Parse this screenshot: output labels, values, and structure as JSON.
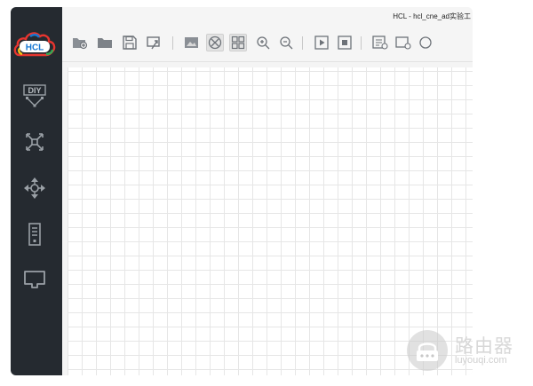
{
  "window": {
    "title": "HCL - hcl_cne_ad实验工"
  },
  "logo": {
    "text": "HCL"
  },
  "sidebar": {
    "items": [
      {
        "label": "DIY",
        "icon": "diy-icon"
      },
      {
        "icon": "router-icon"
      },
      {
        "icon": "switch-icon"
      },
      {
        "icon": "host-icon"
      },
      {
        "icon": "cable-icon"
      }
    ]
  },
  "toolbar": {
    "icons": [
      "new-project-icon",
      "open-folder-icon",
      "save-icon",
      "export-icon",
      "screenshot-icon",
      "topology-icon",
      "grid-view-icon",
      "zoom-in-icon",
      "zoom-out-icon",
      "start-icon",
      "stop-icon",
      "console-icon",
      "capture-icon",
      "circle-icon"
    ]
  },
  "watermark": {
    "name": "路由器",
    "url": "luyouqi.com"
  },
  "colors": {
    "sidebar": "#252a30",
    "grid_line": "#e6e6e6",
    "accent": "#1677d2"
  }
}
